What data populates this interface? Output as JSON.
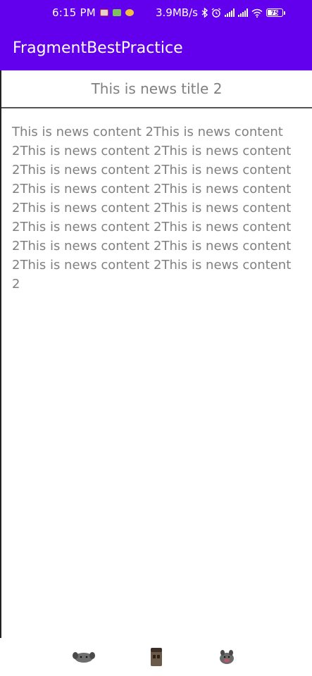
{
  "status_bar": {
    "time": "6:15 PM",
    "net_speed": "3.9MB/s",
    "battery_level": "75",
    "battery_fraction": 0.75,
    "icons": [
      "bluetooth-icon",
      "alarm-icon",
      "signal-icon",
      "hd-signal-icon",
      "wifi-icon",
      "battery-icon"
    ]
  },
  "app_bar": {
    "title": "FragmentBestPractice",
    "color": "#6200ee"
  },
  "news": {
    "title": "This is news title 2",
    "content": "This is news content 2This is news content 2This is news content 2This is news content 2This is news content 2This is news content 2This is news content 2This is news content 2This is news content 2This is news content 2This is news content 2This is news content 2This is news content 2This is news content 2This is news content 2This is news content 2",
    "text_color": "#808080"
  },
  "nav": {
    "icons": [
      "back-nav-icon",
      "home-nav-icon",
      "recents-nav-icon"
    ]
  }
}
